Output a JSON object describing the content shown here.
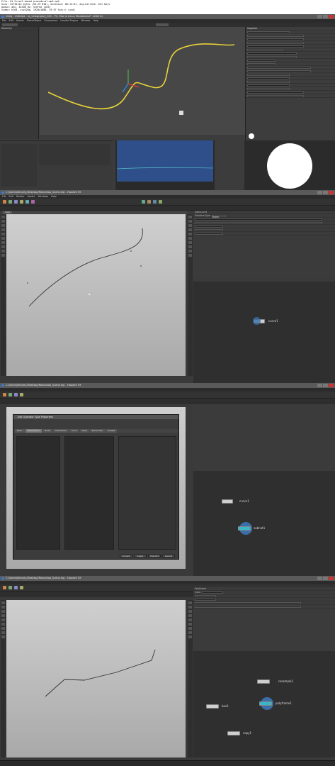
{
  "header": {
    "line1": "File: 01 Curve2 based procedural.mp4 mp4",
    "line2": "Size: 52735113 bytes (50.29 MiB), duration: 00:12:07, avg.bitrate: 611 kb/s",
    "line3": "Audio: aac, 44100 Hz, stereo (und)",
    "line4": "Video: h264, yuv420p, 1920x1080, 29.97 fps(r) (und)"
  },
  "panel1": {
    "title": "Unity - Untitled - sc_Lineproject_001 - PC, Mac & Linux Standalone* <DX11>",
    "menu": [
      "File",
      "Edit",
      "Assets",
      "GameObject",
      "Component",
      "Houdini Engine",
      "Window",
      "Help"
    ],
    "inspector_header": "Inspector",
    "game_tab": "Game"
  },
  "panel2": {
    "title": "C:/Users/Kenney/Desktop/Rescedoo_Scene.hip - Houdini FX",
    "menu": [
      "File",
      "Edit",
      "Render",
      "Assets",
      "Windows",
      "Help"
    ],
    "viewport_tab": "View",
    "path": "/obj/curve1",
    "param_label": "Primitive Type",
    "param_value": "Bezier",
    "node_curve": "curve1"
  },
  "panel3": {
    "title": "C:/Users/Kenney/Desktop/Rescedoo_Scene.hip - Houdini FX",
    "dialog_title": "Edit Operator Type Properties",
    "tabs": [
      "Basic",
      "Parameters",
      "Node",
      "Interactive",
      "Cook",
      "Help",
      "Extra Files",
      "Scripts",
      "Interactive"
    ],
    "node_curve": "curve1",
    "node_subnet": "subnet1",
    "buttons": [
      "Accept",
      "Apply",
      "Discard",
      "Cancel"
    ]
  },
  "panel4": {
    "title": "C:/Users/Kenney/Desktop/Rescedoo_Scene.hip - Houdini FX",
    "param_header": "PolyFrame",
    "param_group": "Input",
    "node_resample": "resample1",
    "node_polyframe": "polyframe1",
    "node_box": "box1",
    "node_copy": "copy1"
  },
  "colors": {
    "accent_blue": "#3a7bd5",
    "curve_yellow": "#e8d23a",
    "node_highlight": "#3ab6c8"
  }
}
